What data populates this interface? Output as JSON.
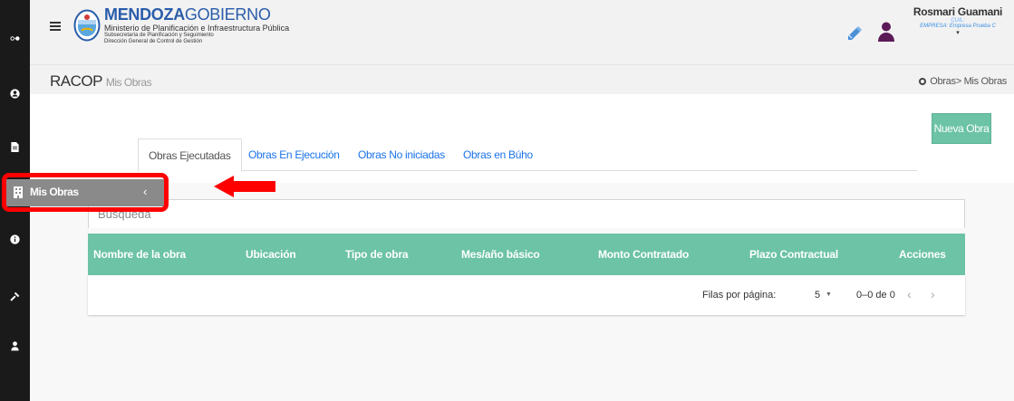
{
  "brand": {
    "name_bold": "MENDOZA",
    "name_light": "GOBIERNO",
    "ministry": "Ministerio de Planificación e Infraestructura Pública",
    "subsecretaria": "Subsecretaría de Planificación y Seguimiento",
    "direccion": "Dirección General de Control de Gestión",
    "color": "#2a5caa"
  },
  "user": {
    "name": "Rosmari Guamani",
    "cuil": "CUIL:",
    "empresa": "EMPRESA: Empresa Prueba C",
    "caret": "▾"
  },
  "page": {
    "title": "RACOP",
    "subtitle": "Mis Obras",
    "breadcrumb": "Obras> Mis Obras"
  },
  "sidebar": {
    "icons": [
      "infinity-icon",
      "user-circle-icon",
      "document-icon",
      "building-icon",
      "info-icon",
      "gavel-icon",
      "person-icon"
    ],
    "flyout_label": "Mis Obras",
    "flyout_chevron": "‹"
  },
  "actions": {
    "new_label": "Nueva Obra"
  },
  "tabs": [
    {
      "label": "Obras Ejecutadas",
      "active": true
    },
    {
      "label": "Obras En Ejecución",
      "active": false
    },
    {
      "label": "Obras No iniciadas",
      "active": false
    },
    {
      "label": "Obras en Búho",
      "active": false
    }
  ],
  "search": {
    "placeholder": "Búsqueda"
  },
  "table": {
    "columns": [
      "Nombre de la obra",
      "Ubicación",
      "Tipo de obra",
      "Mes/año básico",
      "Monto Contratado",
      "Plazo Contractual",
      "Acciones"
    ],
    "rows": []
  },
  "pagination": {
    "rows_label": "Filas por página:",
    "rows_value": "5",
    "range": "0–0 de 0",
    "prev": "‹",
    "next": "›"
  },
  "colors": {
    "accent": "#6cc3a5",
    "link": "#1a73e8",
    "rail": "#1a1a1a",
    "highlight": "#ff0000"
  }
}
